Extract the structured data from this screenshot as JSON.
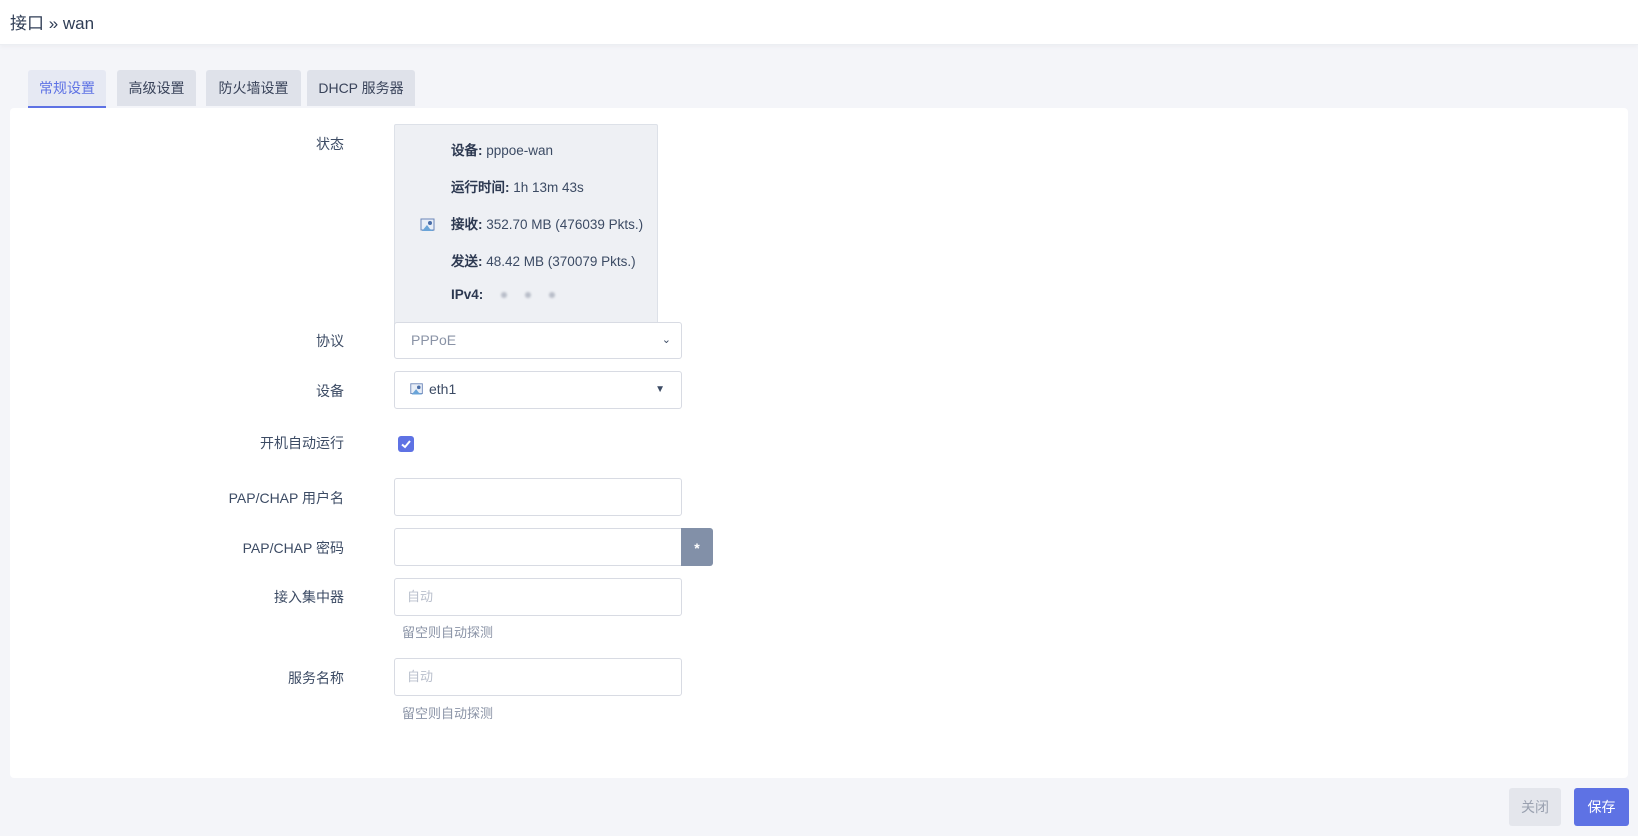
{
  "header": {
    "title": "接口 » wan"
  },
  "tabs": [
    {
      "label": "常规设置",
      "active": true
    },
    {
      "label": "高级设置",
      "active": false
    },
    {
      "label": "防火墙设置",
      "active": false
    },
    {
      "label": "DHCP 服务器",
      "active": false
    }
  ],
  "form": {
    "status": {
      "label": "状态",
      "icon": "network-device-icon",
      "device_key": "设备:",
      "device_value": "pppoe-wan",
      "uptime_key": "运行时间:",
      "uptime_value": "1h 13m 43s",
      "rx_key": "接收:",
      "rx_value": "352.70 MB (476039 Pkts.)",
      "tx_key": "发送:",
      "tx_value": "48.42 MB (370079 Pkts.)",
      "ipv4_key": "IPv4:"
    },
    "protocol": {
      "label": "协议",
      "value": "PPPoE"
    },
    "device": {
      "label": "设备",
      "value": "eth1"
    },
    "autostart": {
      "label": "开机自动运行",
      "checked": true
    },
    "username": {
      "label": "PAP/CHAP 用户名"
    },
    "password": {
      "label": "PAP/CHAP 密码",
      "reveal_label": "*"
    },
    "ac": {
      "label": "接入集中器",
      "placeholder": "自动",
      "hint": "留空则自动探测"
    },
    "service": {
      "label": "服务名称",
      "placeholder": "自动",
      "hint": "留空则自动探测"
    }
  },
  "buttons": {
    "close": "关闭",
    "save": "保存"
  },
  "colors": {
    "accent": "#5e72e4",
    "panel": "#ffffff",
    "background": "#f4f5f9"
  }
}
